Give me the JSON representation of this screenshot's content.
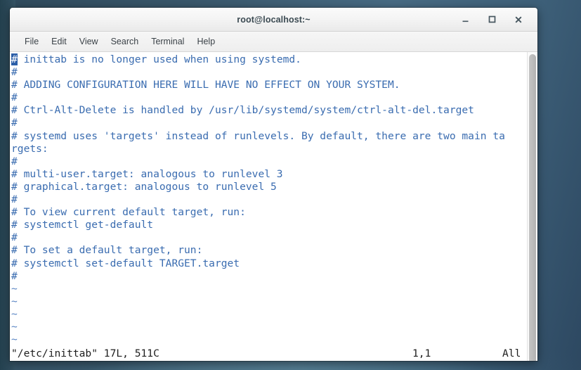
{
  "desktop": {
    "background_color": "#3d5f78"
  },
  "window": {
    "title": "root@localhost:~",
    "controls": [
      {
        "name": "minimize-button",
        "glyph": "_"
      },
      {
        "name": "maximize-button",
        "glyph": "□"
      },
      {
        "name": "close-button",
        "glyph": "✕"
      }
    ]
  },
  "menubar": {
    "items": [
      {
        "label": "File"
      },
      {
        "label": "Edit"
      },
      {
        "label": "View"
      },
      {
        "label": "Search"
      },
      {
        "label": "Terminal"
      },
      {
        "label": "Help"
      }
    ]
  },
  "terminal": {
    "text_color": "#3a6cb0",
    "cursor_color": "#2b5ea8",
    "background_color": "#ffffff",
    "cursor_char": "#",
    "line1_rest": " inittab is no longer used when using systemd.",
    "lines": [
      "#",
      "# ADDING CONFIGURATION HERE WILL HAVE NO EFFECT ON YOUR SYSTEM.",
      "#",
      "# Ctrl-Alt-Delete is handled by /usr/lib/systemd/system/ctrl-alt-del.target",
      "#",
      "# systemd uses 'targets' instead of runlevels. By default, there are two main ta",
      "rgets:",
      "#",
      "# multi-user.target: analogous to runlevel 3",
      "# graphical.target: analogous to runlevel 5",
      "#",
      "# To view current default target, run:",
      "# systemctl get-default",
      "#",
      "# To set a default target, run:",
      "# systemctl set-default TARGET.target",
      "#"
    ],
    "tildes": [
      "~",
      "~",
      "~",
      "~",
      "~"
    ],
    "statusline": {
      "file": "\"/etc/inittab\" 17L, 511C",
      "position": "1,1",
      "percent": "All"
    }
  }
}
